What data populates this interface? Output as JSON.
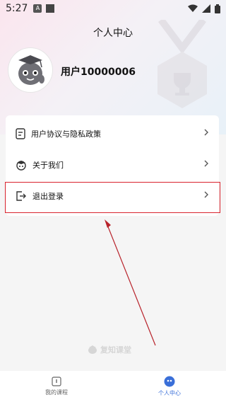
{
  "status_bar": {
    "time": "5:27",
    "notif_label": "A"
  },
  "header": {
    "title": "个人中心"
  },
  "profile": {
    "username": "用户10000006"
  },
  "menu": {
    "items": [
      {
        "label": "用户协议与隐私政策",
        "icon": "document-icon"
      },
      {
        "label": "关于我们",
        "icon": "about-icon"
      },
      {
        "label": "退出登录",
        "icon": "logout-icon"
      }
    ]
  },
  "watermark": {
    "text": "复知课堂"
  },
  "tabbar": {
    "tabs": [
      {
        "label": "我的课程",
        "active": false,
        "icon": "course-icon"
      },
      {
        "label": "个人中心",
        "active": true,
        "icon": "profile-icon"
      }
    ]
  },
  "colors": {
    "active_tab": "#3a6fd8",
    "inactive_tab": "#666666",
    "highlight_box": "#d9232d",
    "annotation_arrow": "#b8232b"
  }
}
